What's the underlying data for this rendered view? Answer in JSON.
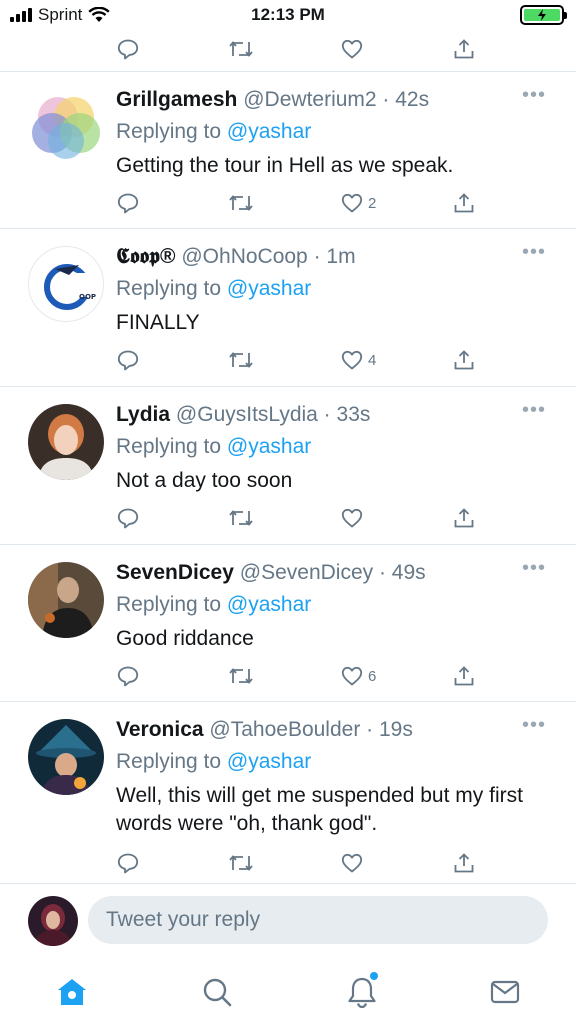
{
  "status_bar": {
    "carrier": "Sprint",
    "time": "12:13 PM"
  },
  "colors": {
    "accent": "#1da1f2",
    "muted": "#657786",
    "divider": "#e1e8ed",
    "battery": "#4cd964"
  },
  "tweets": [
    {
      "name": "Grillgamesh",
      "handle": "@Dewterium2 · 42s",
      "replying_label": "Replying to",
      "replying_to": "@yashar",
      "text": "Getting the tour in Hell as we speak.",
      "likes": "2"
    },
    {
      "name": "𝕮𝖔𝖔𝖕®",
      "handle": "@OhNoCoop · 1m",
      "replying_label": "Replying to",
      "replying_to": "@yashar",
      "text": "FINALLY",
      "likes": "4"
    },
    {
      "name": "Lydia",
      "handle": "@GuysItsLydia · 33s",
      "replying_label": "Replying to",
      "replying_to": "@yashar",
      "text": "Not a day too soon",
      "likes": ""
    },
    {
      "name": "SevenDicey",
      "handle": "@SevenDicey · 49s",
      "replying_label": "Replying to",
      "replying_to": "@yashar",
      "text": "Good riddance",
      "likes": "6"
    },
    {
      "name": "Veronica",
      "handle": "@TahoeBoulder · 19s",
      "replying_label": "Replying to",
      "replying_to": "@yashar",
      "text": "Well, this will get me suspended but my first words were \"oh, thank god\".",
      "likes": ""
    }
  ],
  "reply_bar": {
    "placeholder": "Tweet your reply"
  },
  "tab_bar": [
    "home-icon",
    "search-icon",
    "notifications-icon",
    "messages-icon"
  ]
}
